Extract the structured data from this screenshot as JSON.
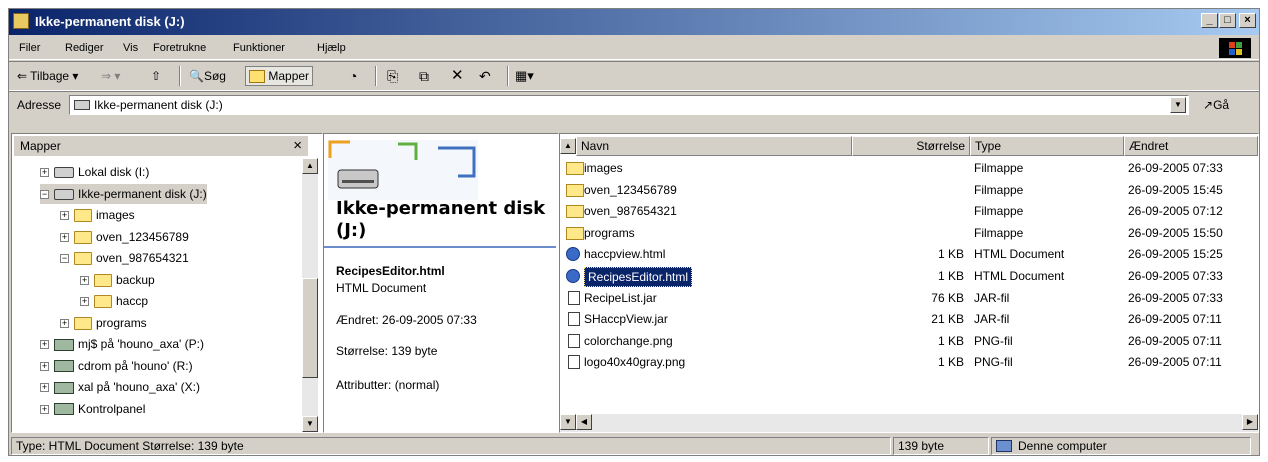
{
  "window": {
    "title": "Ikke-permanent disk (J:)"
  },
  "menu": [
    "Filer",
    "Rediger",
    "Vis",
    "Foretrukne",
    "Funktioner",
    "Hjælp"
  ],
  "toolbar": {
    "back": "Tilbage",
    "search": "Søg",
    "folders": "Mapper"
  },
  "address": {
    "label": "Adresse",
    "value": "Ikke-permanent disk (J:)",
    "go": "Gå"
  },
  "folders_pane": {
    "header": "Mapper",
    "close": "×",
    "items": [
      {
        "label": "Lokal disk (I:)",
        "icon": "drive-icon",
        "expander": "+"
      },
      {
        "label": "Ikke-permanent disk (J:)",
        "icon": "drive-icon",
        "expander": "−"
      },
      {
        "label": "images",
        "icon": "folder-icon",
        "expander": "+"
      },
      {
        "label": "oven_123456789",
        "icon": "folder-icon",
        "expander": "+"
      },
      {
        "label": "oven_987654321",
        "icon": "folder-icon",
        "expander": "−"
      },
      {
        "label": "backup",
        "icon": "folder-icon",
        "expander": "+"
      },
      {
        "label": "haccp",
        "icon": "folder-icon",
        "expander": "+"
      },
      {
        "label": "programs",
        "icon": "folder-icon",
        "expander": "+"
      },
      {
        "label": "mj$ på 'houno_axa' (P:)",
        "icon": "network-drive-icon",
        "expander": "+"
      },
      {
        "label": "cdrom på 'houno' (R:)",
        "icon": "network-drive-icon",
        "expander": "+"
      },
      {
        "label": "xal på 'houno_axa' (X:)",
        "icon": "network-drive-icon",
        "expander": "+"
      },
      {
        "label": "Kontrolpanel",
        "icon": "control-panel-icon",
        "expander": "+"
      }
    ]
  },
  "info_pane": {
    "title": "Ikke-permanent disk (J:)",
    "file_name": "RecipesEditor.html",
    "file_type": "HTML Document",
    "modified": "Ændret: 26-09-2005 07:33",
    "size": "Størrelse: 139 byte",
    "attributes": "Attributter: (normal)"
  },
  "columns": {
    "name": "Navn",
    "size": "Størrelse",
    "type": "Type",
    "modified": "Ændret"
  },
  "files": [
    {
      "name": "images",
      "size": "",
      "type": "Filmappe",
      "modified": "26-09-2005 07:33",
      "icon": "folder-icon"
    },
    {
      "name": "oven_123456789",
      "size": "",
      "type": "Filmappe",
      "modified": "26-09-2005 15:45",
      "icon": "folder-icon"
    },
    {
      "name": "oven_987654321",
      "size": "",
      "type": "Filmappe",
      "modified": "26-09-2005 07:12",
      "icon": "folder-icon"
    },
    {
      "name": "programs",
      "size": "",
      "type": "Filmappe",
      "modified": "26-09-2005 15:50",
      "icon": "folder-icon"
    },
    {
      "name": "haccpview.html",
      "size": "1 KB",
      "type": "HTML Document",
      "modified": "26-09-2005 15:25",
      "icon": "html-icon"
    },
    {
      "name": "RecipesEditor.html",
      "size": "1 KB",
      "type": "HTML Document",
      "modified": "26-09-2005 07:33",
      "icon": "html-icon",
      "selected": true
    },
    {
      "name": "RecipeList.jar",
      "size": "76 KB",
      "type": "JAR-fil",
      "modified": "26-09-2005 07:33",
      "icon": "jar-icon"
    },
    {
      "name": "SHaccpView.jar",
      "size": "21 KB",
      "type": "JAR-fil",
      "modified": "26-09-2005 07:11",
      "icon": "jar-icon"
    },
    {
      "name": "colorchange.png",
      "size": "1 KB",
      "type": "PNG-fil",
      "modified": "26-09-2005 07:11",
      "icon": "png-icon"
    },
    {
      "name": "logo40x40gray.png",
      "size": "1 KB",
      "type": "PNG-fil",
      "modified": "26-09-2005 07:11",
      "icon": "png-icon"
    }
  ],
  "status": {
    "text": "Type: HTML Document Størrelse: 139 byte",
    "size": "139 byte",
    "zone": "Denne computer"
  },
  "colors": {
    "title_start": "#0a246a",
    "title_end": "#a6caf0",
    "selection": "#0a246a",
    "face": "#d4d0c8"
  }
}
